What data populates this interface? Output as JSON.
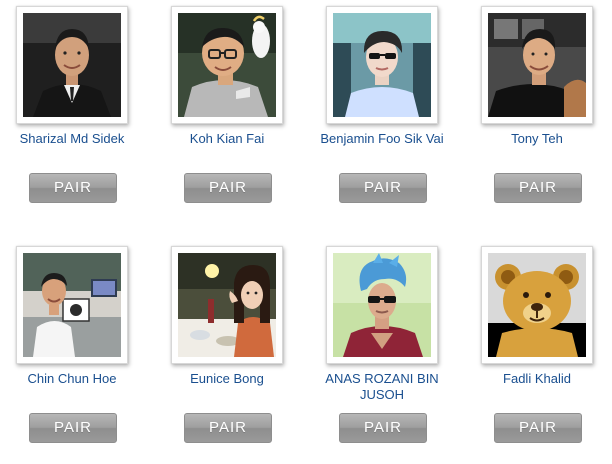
{
  "people": [
    {
      "name": "Sharizal Md Sidek",
      "button": "PAIR",
      "photo": "man-suit-smiling"
    },
    {
      "name": "Koh Kian Fai",
      "button": "PAIR",
      "photo": "man-glasses-with-cockatoo"
    },
    {
      "name": "Benjamin Foo Sik Vai",
      "button": "PAIR",
      "photo": "man-sunglasses-in-car"
    },
    {
      "name": "Tony Teh",
      "button": "PAIR",
      "photo": "man-smiling-black-shirt"
    },
    {
      "name": "Chin Chun Hoe",
      "button": "PAIR",
      "photo": "man-in-office-with-certificate"
    },
    {
      "name": "Eunice Bong",
      "button": "PAIR",
      "photo": "woman-at-dinner-table"
    },
    {
      "name": "ANAS ROZANI BIN JUSOH",
      "button": "PAIR",
      "photo": "man-blue-hair-sunglasses"
    },
    {
      "name": "Fadli Khalid",
      "button": "PAIR",
      "photo": "teddy-bear"
    }
  ]
}
